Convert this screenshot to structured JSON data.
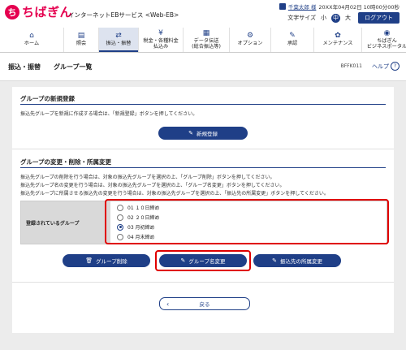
{
  "brand": {
    "logo_mark": "ち",
    "logo_text": "ちばぎん",
    "service_name": "インターネットEBサービス <Web-EB>"
  },
  "user": {
    "name": "千葉太郎 様",
    "datetime": "20XX年04月02日 10時00分00秒"
  },
  "font_size": {
    "label": "文字サイズ",
    "options": [
      "小",
      "中",
      "大"
    ],
    "selected": "中"
  },
  "logout_label": "ログアウト",
  "nav": [
    {
      "icon": "home-icon",
      "glyph": "⌂",
      "label": "ホーム"
    },
    {
      "icon": "document-icon",
      "glyph": "▤",
      "label": "照会"
    },
    {
      "icon": "transfer-icon",
      "glyph": "⇄",
      "label": "振込・振替"
    },
    {
      "icon": "tax-icon",
      "glyph": "¥",
      "label": "税金・各種料金\n払込み"
    },
    {
      "icon": "data-icon",
      "glyph": "▦",
      "label": "データ伝送\n(総合振込等)"
    },
    {
      "icon": "gear-icon",
      "glyph": "⚙",
      "label": "オプション"
    },
    {
      "icon": "approval-icon",
      "glyph": "✎",
      "label": "承認"
    },
    {
      "icon": "wrench-icon",
      "glyph": "✿",
      "label": "メンテナンス"
    },
    {
      "icon": "portal-icon",
      "glyph": "◉",
      "label": "ちばぎん\nビジネスポータル"
    }
  ],
  "page": {
    "breadcrumb": "振込・振替",
    "title": "グループ一覧",
    "screen_id": "BFFK011",
    "help_label": "ヘルプ"
  },
  "new_section": {
    "heading": "グループの新規登録",
    "text": "振込先グループを新規に作成する場合は、「新規登録」ボタンを押してください。",
    "button": "新規登録"
  },
  "change_section": {
    "heading": "グループの変更・削除・所属変更",
    "lines": [
      "振込先グループの削除を行う場合は、対象の振込先グループを選択の上、「グループ削除」ボタンを押してください。",
      "振込先グループ名の変更を行う場合は、対象の振込先グループを選択の上、「グループ名変更」ボタンを押してください。",
      "振込先グループに所属させる振込先の変更を行う場合は、対象の振込先グループを選択の上、「振込先の所属変更」ボタンを押してください。"
    ],
    "table_header": "登録されているグループ",
    "groups": [
      {
        "label": "01 １０日締め",
        "checked": false
      },
      {
        "label": "02 ２０日締め",
        "checked": false
      },
      {
        "label": "03 月初締め",
        "checked": true
      },
      {
        "label": "04 月末締め",
        "checked": false
      }
    ],
    "buttons": {
      "delete": "グループ削除",
      "rename": "グループ名変更",
      "change_members": "振込先の所属変更"
    }
  },
  "back_label": "戻る",
  "colors": {
    "brand": "#e5004f",
    "primary": "#1f3f87",
    "highlight": "#e00000"
  }
}
